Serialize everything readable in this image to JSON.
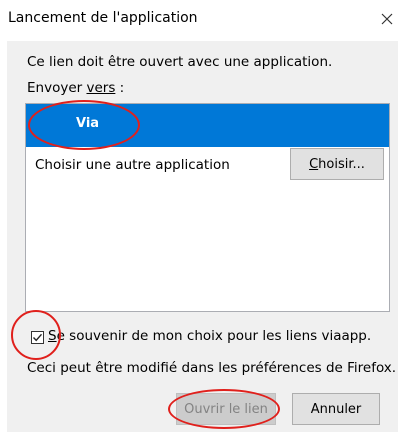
{
  "dialog": {
    "title": "Lancement de l'application",
    "close_glyph": "×",
    "message": "Ce lien doit être ouvert avec une application.",
    "send_to_prefix": "Envoyer ",
    "send_to_underlined": "vers",
    "send_to_suffix": " :"
  },
  "app_list": {
    "items": [
      {
        "label": "Via",
        "selected": true
      },
      {
        "label": "Choisir une autre application",
        "selected": false
      }
    ],
    "choose_button": {
      "label_mnemonic": "C",
      "label_rest": "hoisir..."
    }
  },
  "remember": {
    "checked": true,
    "label_mnemonic": "S",
    "label_rest": "e souvenir de mon choix pour les liens viaapp."
  },
  "hint": "Ceci peut être modifié dans les préférences de Firefox.",
  "buttons": {
    "open": {
      "label": "Ouvrir le lien",
      "enabled": false
    },
    "cancel": {
      "label": "Annuler"
    }
  },
  "annotations": {
    "color": "#e0201c",
    "targets": [
      "Via",
      "remember-checkbox",
      "open-link-button"
    ]
  },
  "colors": {
    "selection": "#0078d7",
    "dialog_background": "#f0f0f0",
    "button_face": "#e1e1e1",
    "disabled_button": "#cccccc",
    "disabled_text": "#838383"
  }
}
